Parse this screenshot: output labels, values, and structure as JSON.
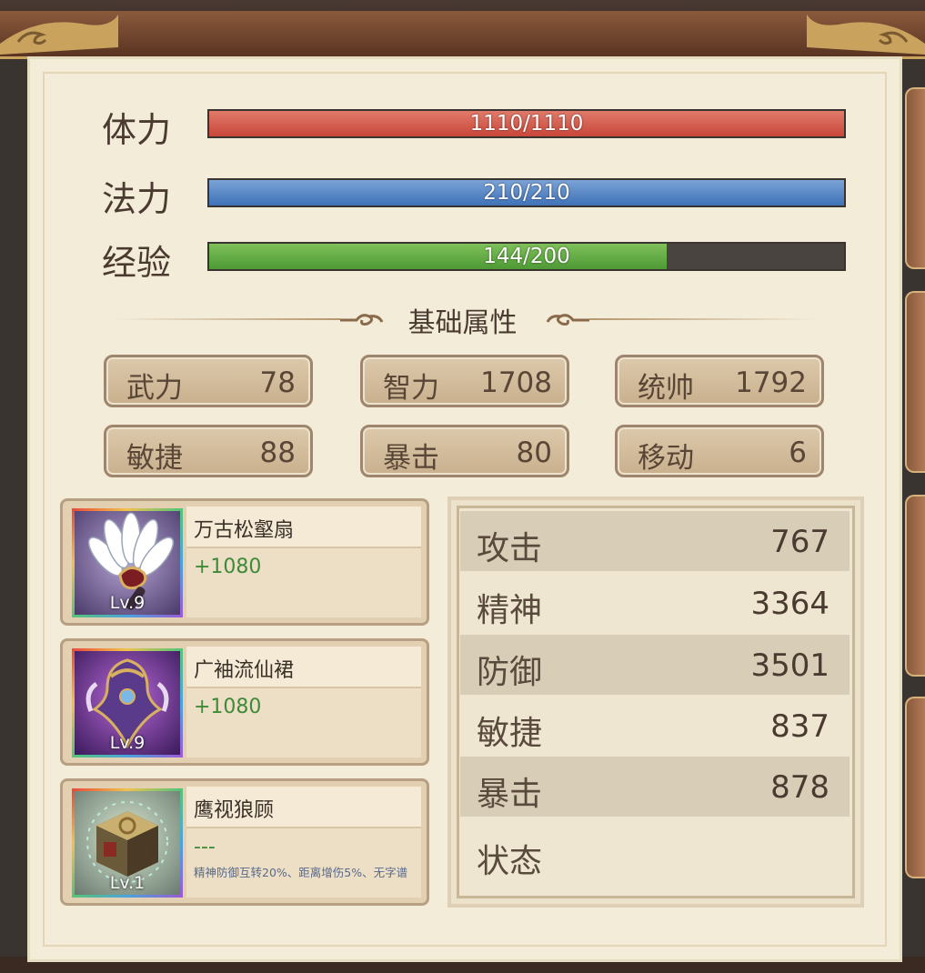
{
  "vitals": {
    "hp": {
      "label": "体力",
      "text": "1110/1110",
      "fraction": 1.0,
      "color": "#c9473a"
    },
    "mp": {
      "label": "法力",
      "text": "210/210",
      "fraction": 1.0,
      "color": "#3f72b8"
    },
    "exp": {
      "label": "经验",
      "text": "144/200",
      "fraction": 0.72,
      "color": "#4d9a35"
    }
  },
  "section": {
    "title": "基础属性"
  },
  "attributes": [
    {
      "label": "武力",
      "value": "78"
    },
    {
      "label": "智力",
      "value": "1708"
    },
    {
      "label": "统帅",
      "value": "1792"
    },
    {
      "label": "敏捷",
      "value": "88"
    },
    {
      "label": "暴击",
      "value": "80"
    },
    {
      "label": "移动",
      "value": "6"
    }
  ],
  "equipment": [
    {
      "name": "万古松壑扇",
      "bonus": "+1080",
      "level": "Lv.9",
      "icon": "feather-fan-icon",
      "desc": ""
    },
    {
      "name": "广袖流仙裙",
      "bonus": "+1080",
      "level": "Lv.9",
      "icon": "robe-icon",
      "desc": ""
    },
    {
      "name": "鹰视狼顾",
      "bonus": "---",
      "level": "Lv.1",
      "icon": "golden-cube-icon",
      "desc": "精神防御互转20%、距离增伤5%、无字谱"
    }
  ],
  "combat_stats": [
    {
      "label": "攻击",
      "value": "767"
    },
    {
      "label": "精神",
      "value": "3364"
    },
    {
      "label": "防御",
      "value": "3501"
    },
    {
      "label": "敏捷",
      "value": "837"
    },
    {
      "label": "暴击",
      "value": "878"
    },
    {
      "label": "状态",
      "value": ""
    }
  ]
}
